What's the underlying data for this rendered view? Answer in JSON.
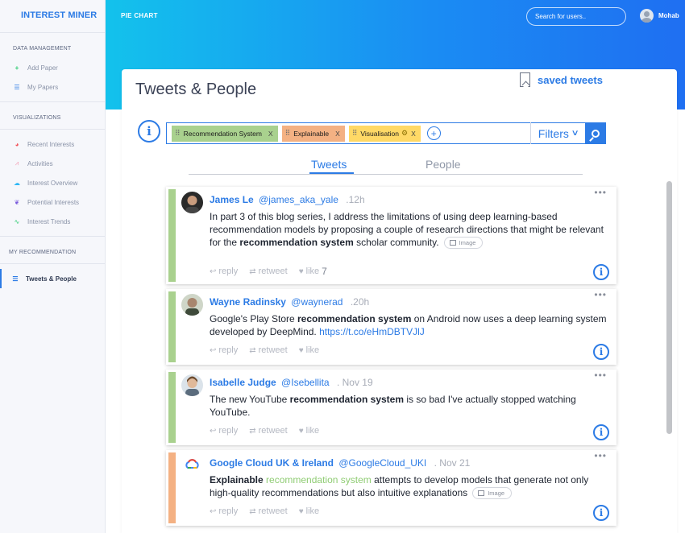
{
  "app": {
    "brand": "INTEREST MINER"
  },
  "header": {
    "crumb": "PIE CHART",
    "search_placeholder": "Search for users..",
    "user_name": "Mohab"
  },
  "sidebar": {
    "section_data": "DATA MANAGEMENT",
    "section_vis": "VISUALIZATIONS",
    "section_rec": "MY RECOMMENDATION",
    "data_items": [
      {
        "label": "Add Paper",
        "icon": "plus-icon"
      },
      {
        "label": "My Papers",
        "icon": "list-icon"
      }
    ],
    "vis_items": [
      {
        "label": "Recent Interests",
        "icon": "pie-icon",
        "color": "#f2545b"
      },
      {
        "label": "Activities",
        "icon": "line-chart-icon",
        "color": "#f39bb1"
      },
      {
        "label": "Interest Overview",
        "icon": "cloud-icon",
        "color": "#2db7f5"
      },
      {
        "label": "Potential Interests",
        "icon": "brain-icon",
        "color": "#7a5cdc"
      },
      {
        "label": "Interest Trends",
        "icon": "trend-icon",
        "color": "#2ecc71"
      }
    ],
    "rec_items": [
      {
        "label": "Tweets & People",
        "icon": "list-icon"
      }
    ]
  },
  "page": {
    "title": "Tweets & People",
    "saved_label": "saved tweets",
    "info_glyph": "i",
    "tags": [
      {
        "label": "Recommendation System",
        "color": "#a9d18e",
        "close": "X"
      },
      {
        "label": "Explainable",
        "color": "#f4b183",
        "close": "X"
      },
      {
        "label": "Visualisation",
        "color": "#ffd966",
        "close": "X"
      }
    ],
    "add_glyph": "+",
    "filters_label": "Filters",
    "tabs": {
      "tweets": "Tweets",
      "people": "People",
      "active": "Tweets"
    }
  },
  "tweets": [
    {
      "name": "James Le",
      "handle": "@james_aka_yale",
      "time": ".12h",
      "bar_color": "green",
      "text_parts": [
        {
          "t": "In part 3 of this blog series, I address the limitations of using deep learning-based recommendation models by proposing a couple of research directions that might be relevant for the ",
          "s": "normal"
        },
        {
          "t": "recommendation system",
          "s": "bold"
        },
        {
          "t": " scholar community.",
          "s": "normal"
        }
      ],
      "has_image": true,
      "image_label": "Image",
      "reply": "reply",
      "retweet": "retweet",
      "like": "like",
      "like_count": "7"
    },
    {
      "name": "Wayne Radinsky",
      "handle": "@waynerad",
      "time": ".20h",
      "bar_color": "green",
      "text_parts": [
        {
          "t": "Google's Play Store ",
          "s": "normal"
        },
        {
          "t": "recommendation system",
          "s": "bold"
        },
        {
          "t": " on Android now uses a deep learning system developed by DeepMind. ",
          "s": "normal"
        },
        {
          "t": "https://t.co/eHmDBTVJlJ",
          "s": "link"
        }
      ],
      "has_image": false,
      "reply": "reply",
      "retweet": "retweet",
      "like": "like",
      "like_count": ""
    },
    {
      "name": "Isabelle Judge",
      "handle": "@Isebellita",
      "time": ". Nov 19",
      "bar_color": "green",
      "text_parts": [
        {
          "t": "The new YouTube ",
          "s": "normal"
        },
        {
          "t": "recommendation system",
          "s": "bold"
        },
        {
          "t": " is so bad I've actually stopped watching YouTube.",
          "s": "normal"
        }
      ],
      "has_image": false,
      "reply": "reply",
      "retweet": "retweet",
      "like": "like",
      "like_count": ""
    },
    {
      "name": "Google Cloud UK & Ireland",
      "handle": "@GoogleCloud_UKI",
      "time": ". Nov 21",
      "bar_color": "orange",
      "text_parts": [
        {
          "t": "Explainable",
          "s": "bold"
        },
        {
          "t": " ",
          "s": "normal"
        },
        {
          "t": "recommendation system",
          "s": "highlight"
        },
        {
          "t": " attempts to develop models that generate not only high-quality recommendations but also intuitive explanations",
          "s": "normal"
        }
      ],
      "has_image": true,
      "image_label": "Image",
      "reply": "reply",
      "retweet": "retweet",
      "like": "like",
      "like_count": ""
    }
  ]
}
